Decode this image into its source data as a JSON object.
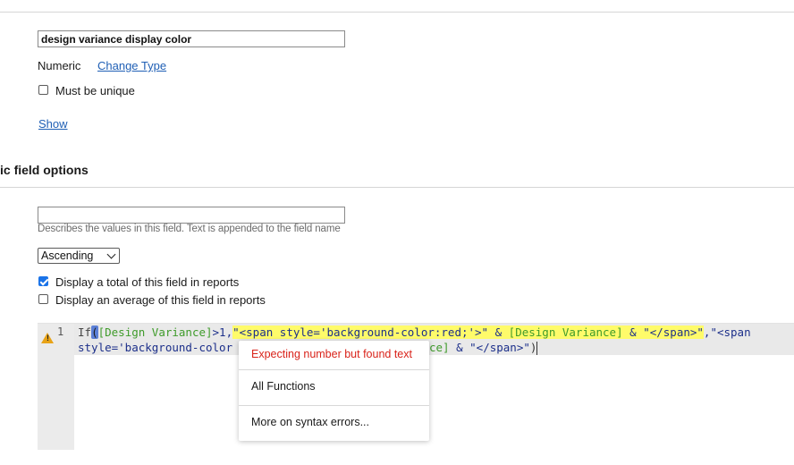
{
  "properties": {
    "field_name_value": "design variance display color",
    "type_label": "Numeric",
    "change_type_link": "Change Type",
    "must_be_unique_label": "Must be unique",
    "show_link": "Show"
  },
  "numeric_options": {
    "section_title": "ic field options",
    "units_hint": "Describes the values in this field. Text is appended to the field name",
    "sort_select": "Ascending",
    "display_total_label": "Display a total of this field in reports",
    "display_total_checked": true,
    "display_average_label": "Display an average of this field in reports",
    "display_average_checked": false
  },
  "editor": {
    "line_number": "1",
    "warning_icon": "warning-triangle-icon",
    "line1": {
      "p1": "If",
      "p2": "(",
      "p3": "[Design Variance]",
      "p4": ">1,",
      "p5": "\"<span style='background-color:red;'>\"",
      "p6": " & ",
      "p7": "[Design Variance]",
      "p8": " & ",
      "p9": "\"</span>\"",
      "p10": ",",
      "p11": "\"<span"
    },
    "line2": {
      "p1": "style='background-color",
      "p2": "ce]",
      "p3": " & ",
      "p4": "\"</span>\"",
      "p5": ")"
    }
  },
  "popup": {
    "error_text": "Expecting number but found text",
    "all_functions": "All Functions",
    "syntax_errors": "More on syntax errors..."
  }
}
